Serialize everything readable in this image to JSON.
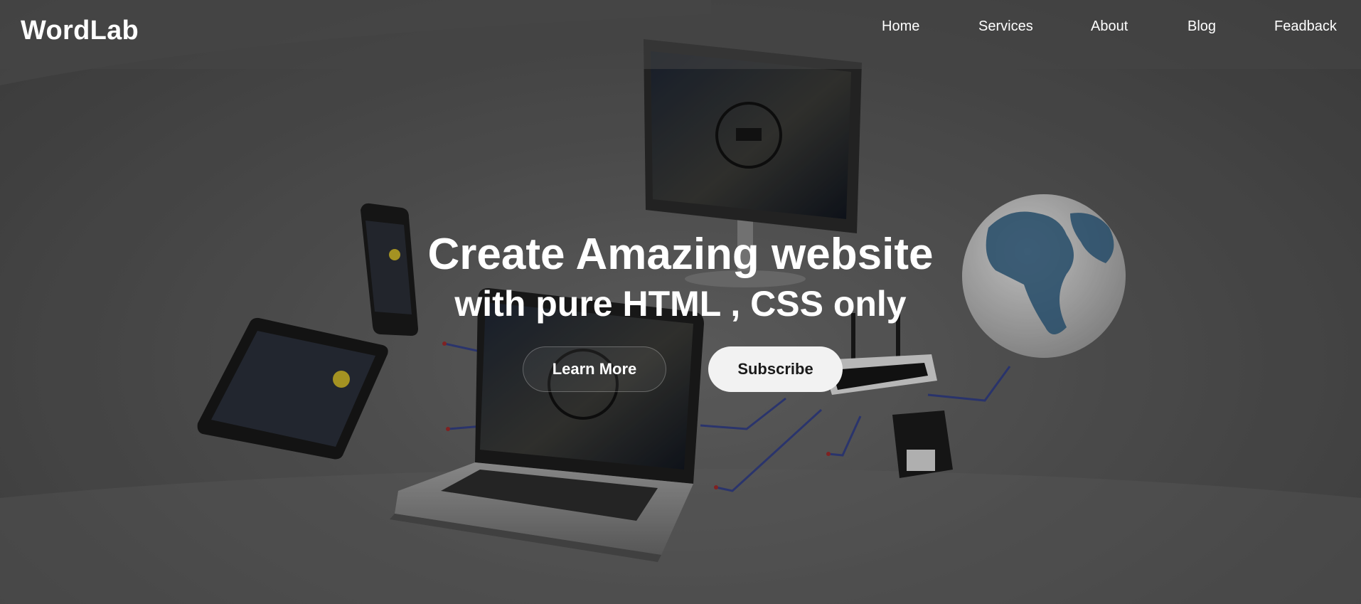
{
  "brand": {
    "name": "WordLab"
  },
  "nav": {
    "items": [
      {
        "label": "Home"
      },
      {
        "label": "Services"
      },
      {
        "label": "About"
      },
      {
        "label": "Blog"
      },
      {
        "label": "Feadback"
      }
    ]
  },
  "hero": {
    "title": "Create Amazing website",
    "subtitle": "with pure HTML , CSS only",
    "buttons": {
      "primary": "Learn More",
      "secondary": "Subscribe"
    }
  },
  "colors": {
    "text": "#ffffff",
    "button_light": "#f2f2f2",
    "button_dark_text": "#1a1a1a"
  },
  "icons": [
    "monitor-illustration",
    "laptop-illustration",
    "tablet-illustration",
    "phone-illustration",
    "router-illustration",
    "globe-illustration",
    "speaker-illustration",
    "cart-icon"
  ]
}
